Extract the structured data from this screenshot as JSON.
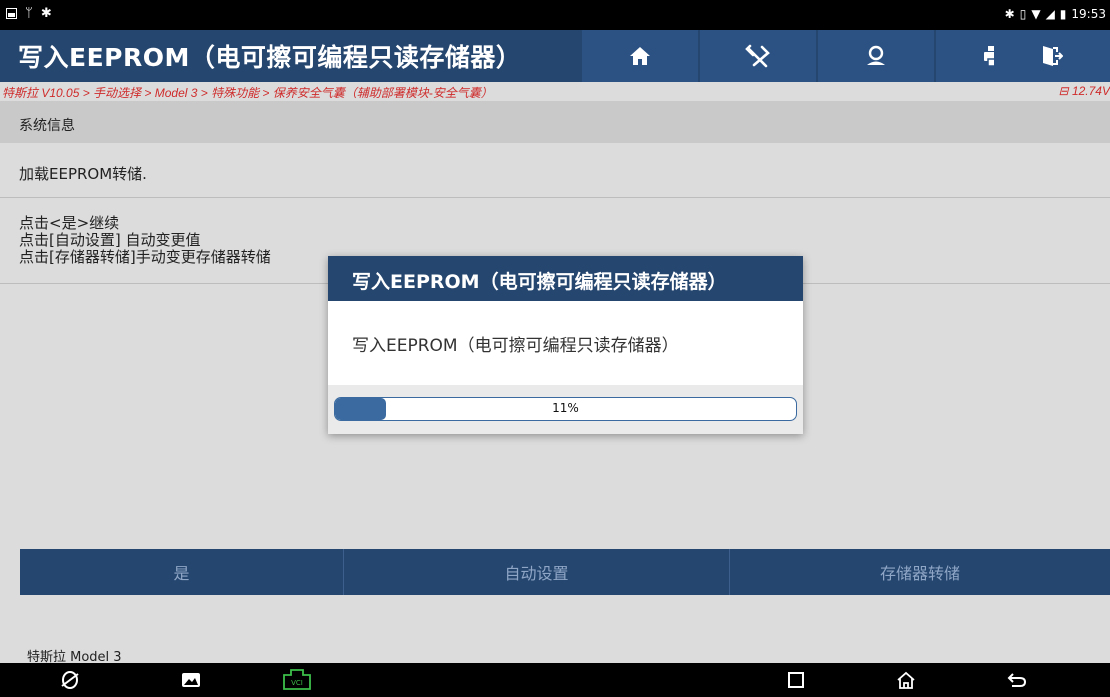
{
  "status_bar": {
    "time": "19:53"
  },
  "header": {
    "title": "写入EEPROM（电可擦可编程只读存储器）",
    "buttons": [
      {
        "icon": "home-icon"
      },
      {
        "icon": "wrench-icon"
      },
      {
        "icon": "user-icon"
      },
      {
        "icon": "print-icon"
      },
      {
        "icon": "exit-icon"
      }
    ]
  },
  "breadcrumb": {
    "path": "特斯拉 V10.05 > 手动选择 > Model 3 > 特殊功能 > 保养安全气囊（辅助部署模块-安全气囊）",
    "voltage": "12.74V"
  },
  "section": {
    "title": "系统信息"
  },
  "content": {
    "line1": "加载EEPROM转储.",
    "instructions": [
      "点击<是>继续",
      "点击[自动设置] 自动变更值",
      "点击[存储器转储]手动变更存储器转储"
    ]
  },
  "actions": {
    "yes": "是",
    "auto_setup": "自动设置",
    "memory_dump": "存储器转储"
  },
  "footer": {
    "vehicle": "特斯拉 Model 3"
  },
  "dialog": {
    "title": "写入EEPROM（电可擦可编程只读存储器）",
    "message": "写入EEPROM（电可擦可编程只读存储器）",
    "progress_percent": 11,
    "progress_label": "11%"
  },
  "colors": {
    "header_bg": "#25466f",
    "breadcrumb_text": "#cf2b2b",
    "progress": "#3a6aa0"
  }
}
